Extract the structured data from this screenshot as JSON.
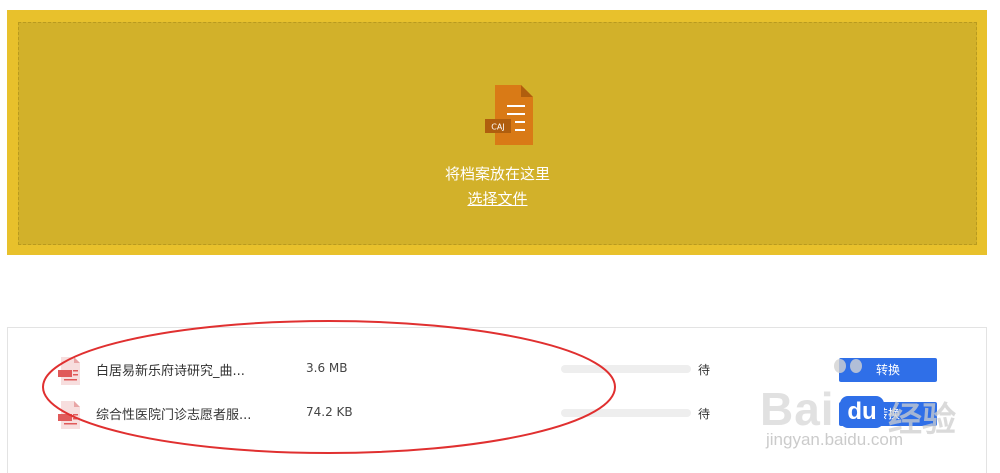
{
  "dropzone": {
    "icon_name": "caj-file-icon",
    "icon_label": "CAJ",
    "drop_text": "将档案放在这里",
    "choose_file_label": "选择文件",
    "colors": {
      "outer": "#e8c12c",
      "inner": "#d2b12a",
      "icon": "#d97a16"
    }
  },
  "files": [
    {
      "name": "白居易新乐府诗研究_曲...",
      "size": "3.6 MB",
      "progress": 0,
      "status": "待",
      "action_label": "转换"
    },
    {
      "name": "综合性医院门诊志愿者服...",
      "size": "74.2 KB",
      "progress": 0,
      "status": "待",
      "action_label": "转换"
    }
  ],
  "watermark": {
    "brand_left": "Bai",
    "brand_du": "du",
    "brand_cn": "经验",
    "url": "jingyan.baidu.com"
  },
  "colors": {
    "accent": "#2f6fe8",
    "annotation": "#e03030",
    "pdf_icon": "#e05a5a"
  }
}
